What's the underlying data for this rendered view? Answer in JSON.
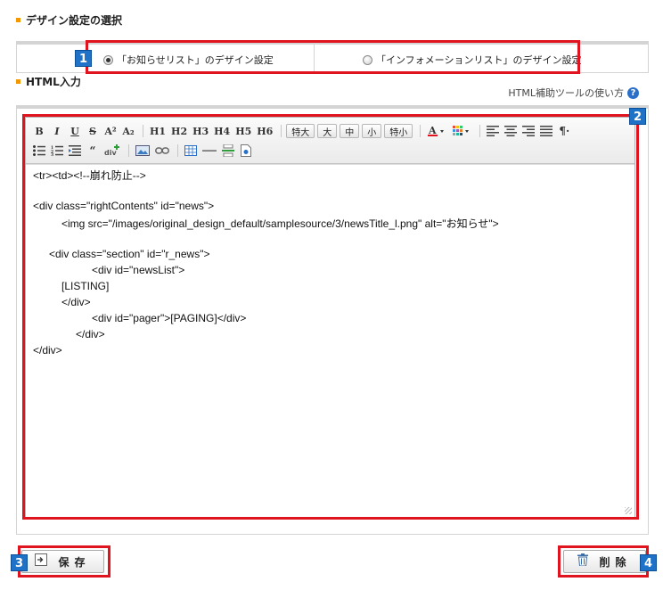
{
  "sections": {
    "design_heading": "デザイン設定の選択",
    "html_heading": "HTML入力"
  },
  "design_options": [
    {
      "label": "「お知らせリスト」のデザイン設定",
      "selected": true
    },
    {
      "label": "「インフォメーションリスト」のデザイン設定",
      "selected": false
    }
  ],
  "help": {
    "label": "HTML補助ツールの使い方",
    "icon": "question-icon"
  },
  "toolbar": {
    "format_buttons": [
      "B",
      "I",
      "U",
      "S",
      "A²",
      "A₂"
    ],
    "heading_buttons": [
      "H1",
      "H2",
      "H3",
      "H4",
      "H5",
      "H6"
    ],
    "size_buttons": [
      "特大",
      "大",
      "中",
      "小",
      "特小"
    ],
    "icons": [
      "font-color-icon",
      "background-color-icon",
      "align-left-icon",
      "align-center-icon",
      "align-right-icon",
      "justify-icon",
      "paragraph-icon",
      "bullet-list-icon",
      "numbered-list-icon",
      "indent-icon",
      "quote-icon",
      "div-insert-icon",
      "image-icon",
      "link-icon",
      "table-icon",
      "horizontal-rule-icon",
      "page-break-icon",
      "document-icon"
    ]
  },
  "code_lines": [
    "<tr><td><!--崩れ防止-->",
    "",
    "<div class=\"rightContents\" id=\"news\">",
    "\t<img src=\"/images/original_design_default/samplesource/3/newsTitle_l.png\" alt=\"お知らせ\">",
    "",
    "   <div class=\"section\" id=\"r_news\">",
    "\t\t<div id=\"newsList\">",
    "\t[LISTING]",
    "\t</div>",
    "\t\t<div id=\"pager\">[PAGING]</div>",
    "\t</div>",
    "</div>"
  ],
  "buttons": {
    "save": "保存",
    "delete": "削除"
  },
  "badges": [
    "1",
    "2",
    "3",
    "4"
  ],
  "colors": {
    "highlight": "#e0141e",
    "badge": "#1e73c8",
    "accent": "#f39800"
  }
}
